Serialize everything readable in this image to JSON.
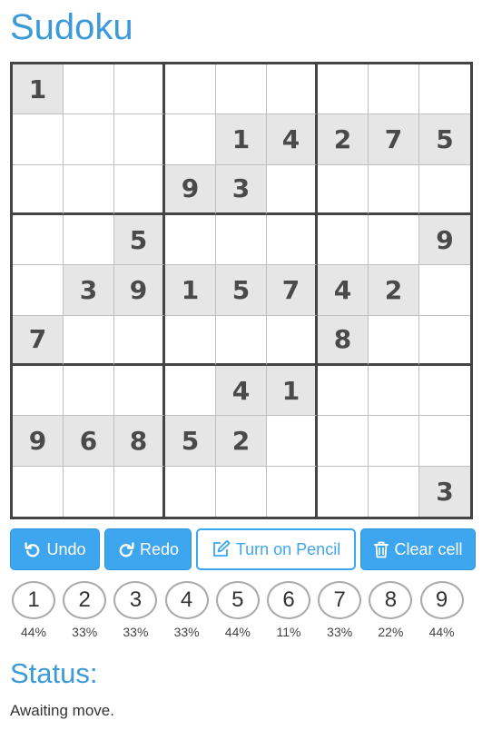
{
  "title": "Sudoku",
  "colors": {
    "accent": "#3ea6ee",
    "heading": "#3d9ad8",
    "given_bg": "#e6e6e6",
    "grid_line": "#444444"
  },
  "board": [
    [
      1,
      0,
      0,
      0,
      0,
      0,
      0,
      0,
      0
    ],
    [
      0,
      0,
      0,
      0,
      1,
      4,
      2,
      7,
      5
    ],
    [
      0,
      0,
      0,
      9,
      3,
      0,
      0,
      0,
      0
    ],
    [
      0,
      0,
      5,
      0,
      0,
      0,
      0,
      0,
      9
    ],
    [
      0,
      3,
      9,
      1,
      5,
      7,
      4,
      2,
      0
    ],
    [
      7,
      0,
      0,
      0,
      0,
      0,
      8,
      0,
      0
    ],
    [
      0,
      0,
      0,
      0,
      4,
      1,
      0,
      0,
      0
    ],
    [
      9,
      6,
      8,
      5,
      2,
      0,
      0,
      0,
      0
    ],
    [
      0,
      0,
      0,
      0,
      0,
      0,
      0,
      0,
      3
    ]
  ],
  "toolbar": {
    "undo": {
      "label": "Undo",
      "icon": "undo-icon"
    },
    "redo": {
      "label": "Redo",
      "icon": "redo-icon"
    },
    "pencil": {
      "label": "Turn on Pencil",
      "icon": "pencil-icon"
    },
    "clear": {
      "label": "Clear cell",
      "icon": "trash-icon"
    }
  },
  "numbers": [
    {
      "digit": "1",
      "percent": "44%"
    },
    {
      "digit": "2",
      "percent": "33%"
    },
    {
      "digit": "3",
      "percent": "33%"
    },
    {
      "digit": "4",
      "percent": "33%"
    },
    {
      "digit": "5",
      "percent": "44%"
    },
    {
      "digit": "6",
      "percent": "11%"
    },
    {
      "digit": "7",
      "percent": "33%"
    },
    {
      "digit": "8",
      "percent": "22%"
    },
    {
      "digit": "9",
      "percent": "44%"
    }
  ],
  "status": {
    "heading": "Status:",
    "text": "Awaiting move."
  }
}
